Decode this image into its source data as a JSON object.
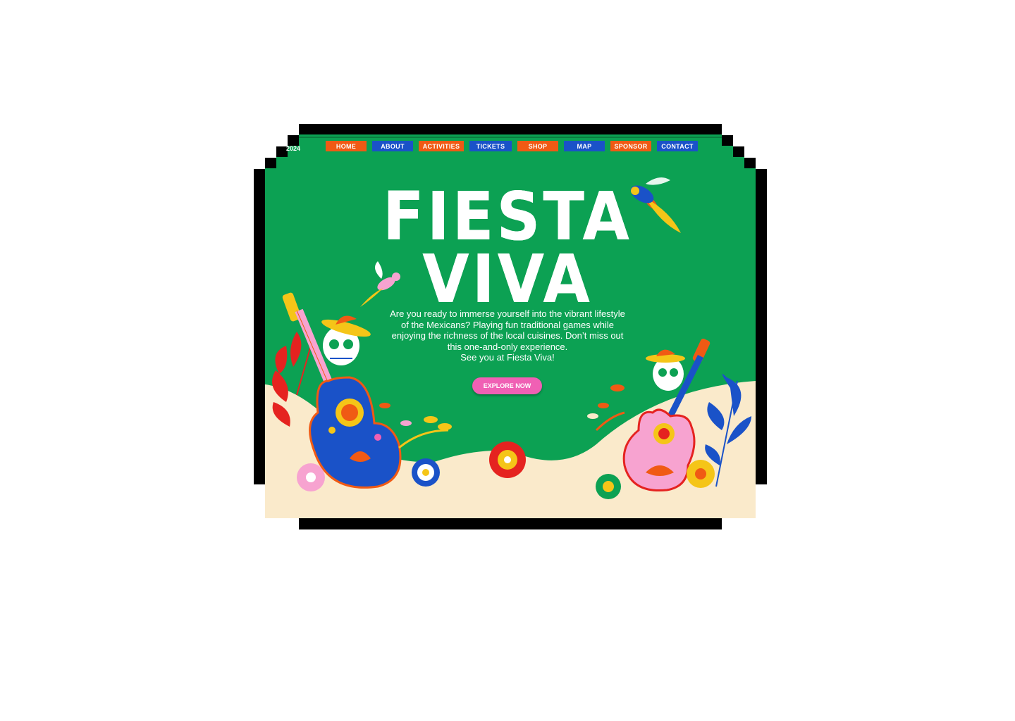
{
  "header": {
    "year_left": "2024",
    "year_right": ""
  },
  "nav": {
    "items": [
      {
        "label": "HOME",
        "color": "#f05a14"
      },
      {
        "label": "ABOUT",
        "color": "#1a52c8"
      },
      {
        "label": "ACTIVITIES",
        "color": "#f05a14"
      },
      {
        "label": "TICKETS",
        "color": "#1a52c8"
      },
      {
        "label": "SHOP",
        "color": "#f05a14"
      },
      {
        "label": "MAP",
        "color": "#1a52c8"
      },
      {
        "label": "SPONSOR",
        "color": "#f05a14"
      },
      {
        "label": "CONTACT",
        "color": "#1a52c8"
      }
    ]
  },
  "hero": {
    "title_line1": "FIESTA",
    "title_line2": "VIVA",
    "description_lines": [
      "Are you ready to immerse yourself into the vibrant lifestyle",
      "of the Mexicans? Playing fun traditional games while",
      "enjoying the richness of the local cuisines. Don’t miss out",
      "this one-and-only experience.",
      "See you at Fiesta Viva!"
    ],
    "cta_label": "EXPLORE NOW"
  },
  "colors": {
    "background_green": "#0ca153",
    "sand": "#faeacb",
    "accent_pink": "#f060b4",
    "accent_orange": "#f05a14",
    "accent_blue": "#1a52c8"
  },
  "icons": [
    "parrot-icon",
    "guitar-icon",
    "sugar-skull-icon",
    "sombrero-icon",
    "flower-icon",
    "leaf-icon"
  ]
}
